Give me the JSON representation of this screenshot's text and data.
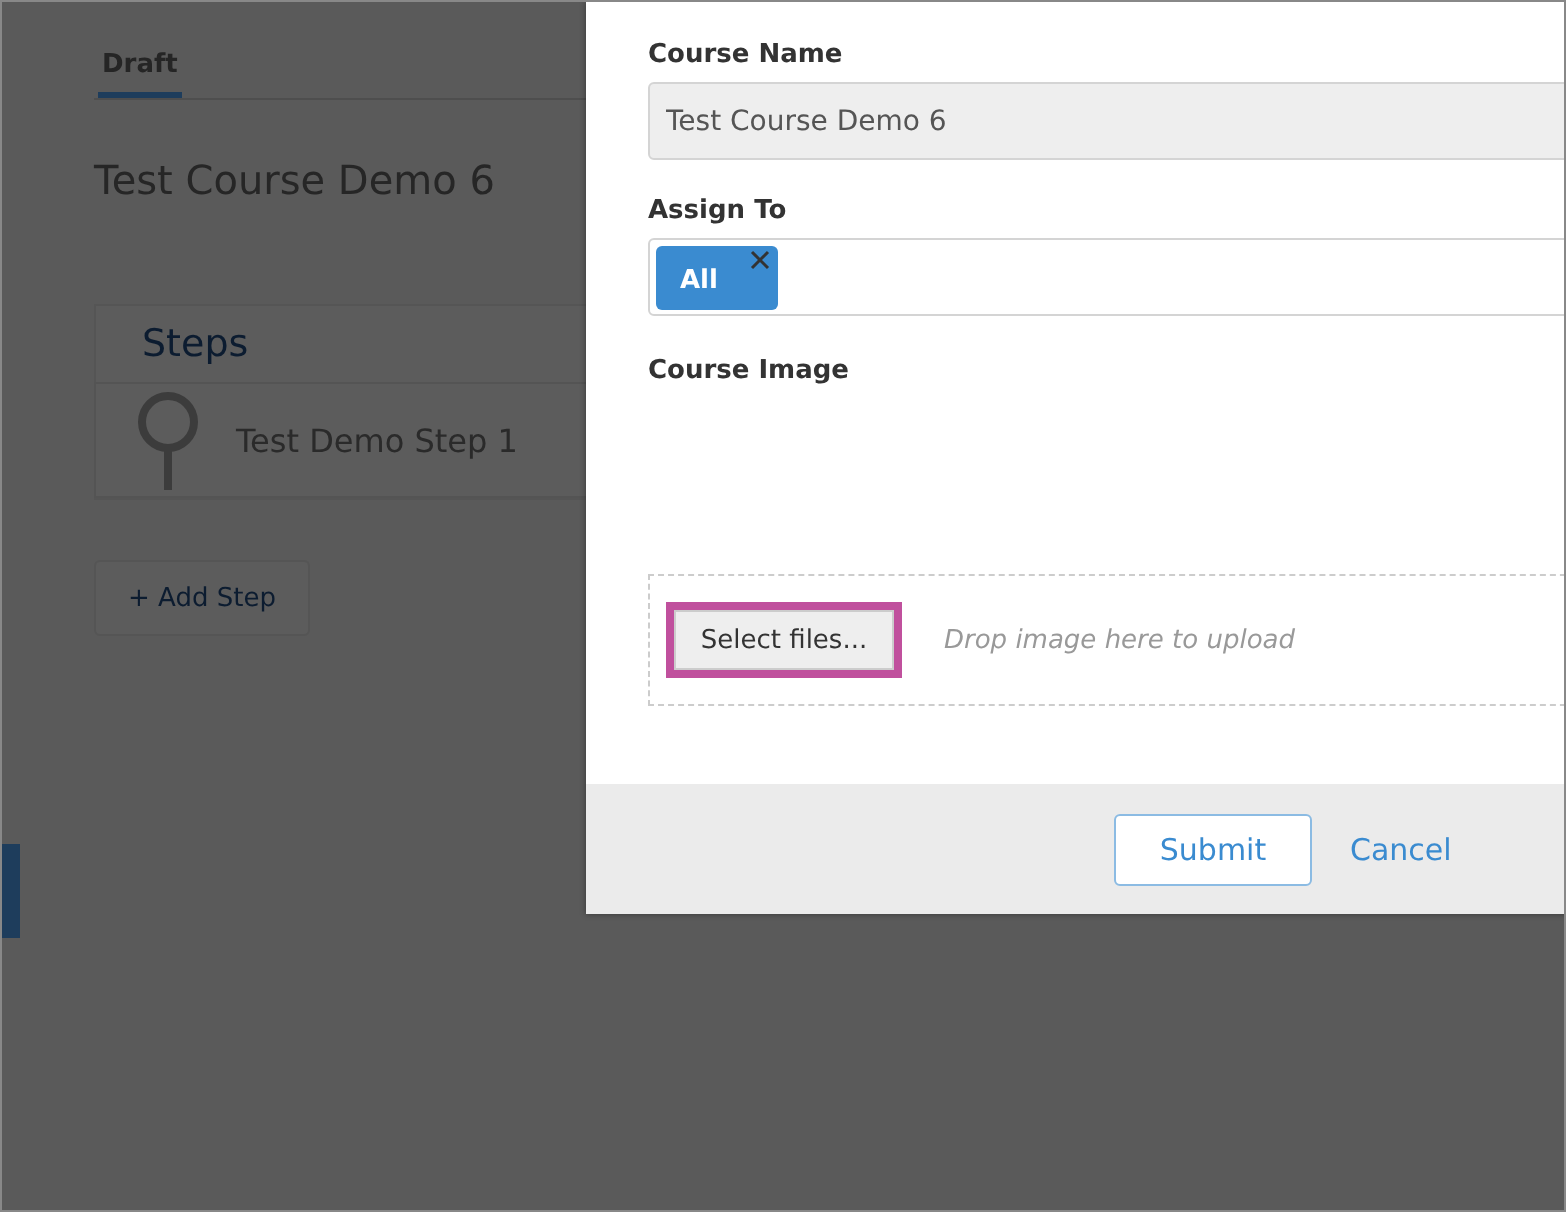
{
  "background_page": {
    "tabs": [
      {
        "label": "Draft",
        "selected": true
      }
    ],
    "title": "Test Course Demo 6",
    "steps_panel": {
      "heading": "Steps",
      "items": [
        {
          "label": "Test Demo Step 1"
        }
      ]
    },
    "add_step_button": "+ Add Step"
  },
  "dialog": {
    "fields": [
      {
        "kind": "text",
        "label": "Course Name",
        "value": "Test Course Demo 6"
      },
      {
        "kind": "tags",
        "label": "Assign To",
        "tags": [
          "All"
        ]
      },
      {
        "kind": "upload",
        "label": "Course Image",
        "button": "Select files...",
        "highlighted": true,
        "hint": "Drop image here to upload"
      }
    ],
    "buttons": [
      {
        "label": "Submit",
        "kind": "primary"
      },
      {
        "label": "Cancel",
        "kind": "link"
      }
    ]
  }
}
